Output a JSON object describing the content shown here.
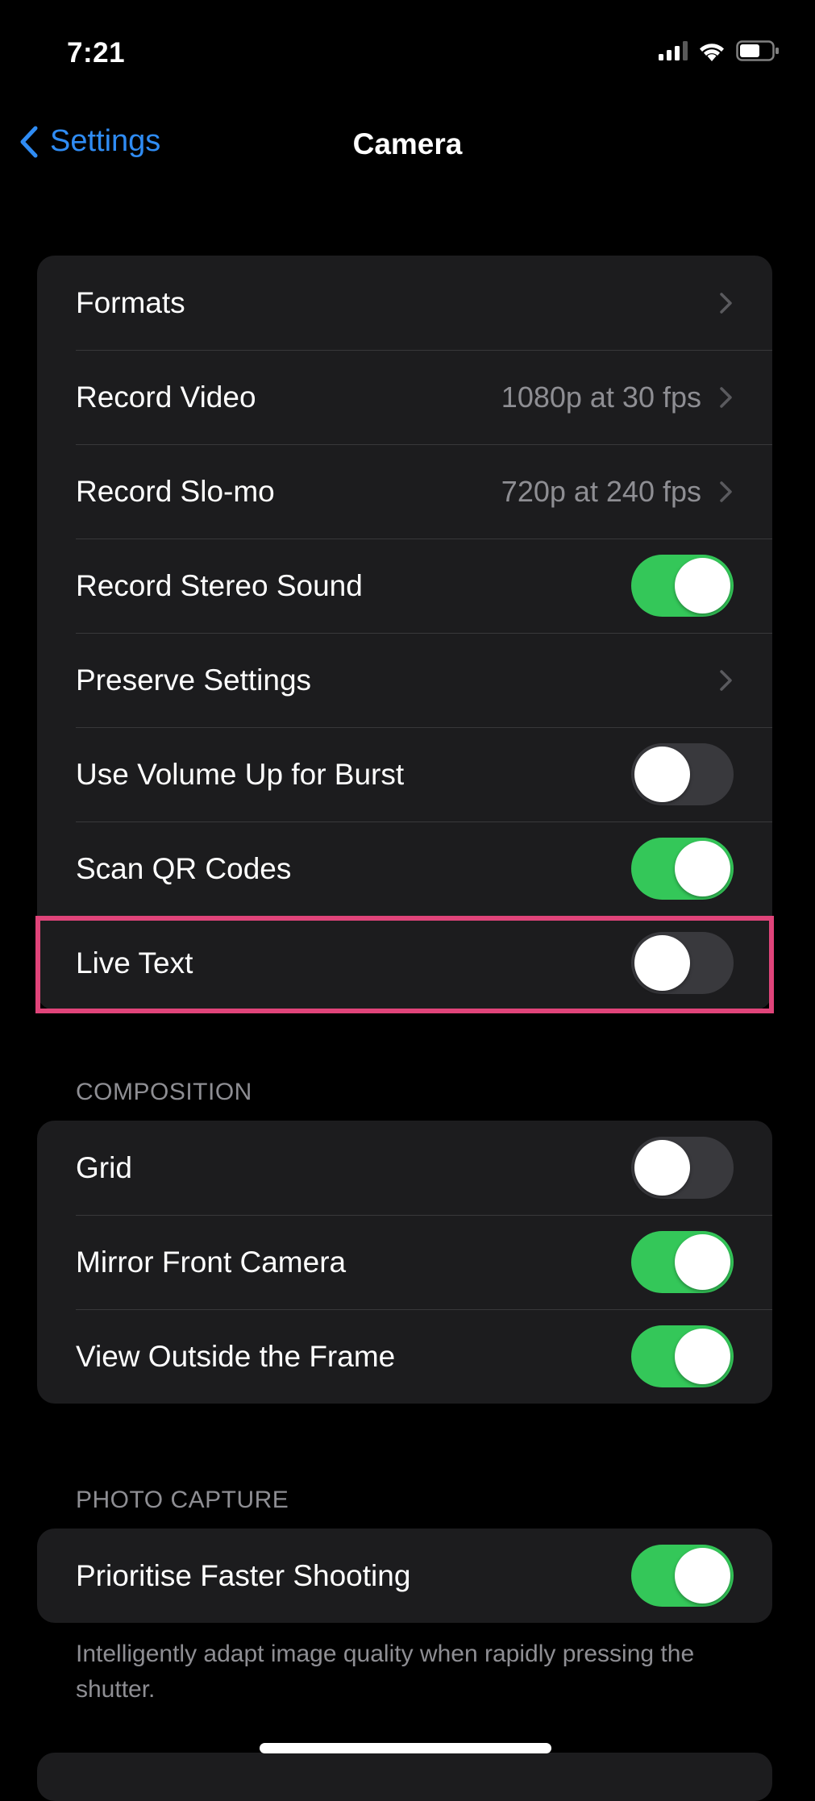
{
  "status_bar": {
    "time": "7:21",
    "icons": [
      "cellular-signal-icon",
      "wifi-icon",
      "battery-icon"
    ]
  },
  "nav": {
    "back_label": "Settings",
    "title": "Camera"
  },
  "colors": {
    "accent": "#2f8cf4",
    "toggle_on": "#34c759",
    "toggle_off": "#39393d",
    "highlight": "#e0447a"
  },
  "main_group": {
    "rows": [
      {
        "label": "Formats",
        "type": "disclosure",
        "value": ""
      },
      {
        "label": "Record Video",
        "type": "disclosure",
        "value": "1080p at 30 fps"
      },
      {
        "label": "Record Slo-mo",
        "type": "disclosure",
        "value": "720p at 240 fps"
      },
      {
        "label": "Record Stereo Sound",
        "type": "toggle",
        "on": true
      },
      {
        "label": "Preserve Settings",
        "type": "disclosure",
        "value": ""
      },
      {
        "label": "Use Volume Up for Burst",
        "type": "toggle",
        "on": false
      },
      {
        "label": "Scan QR Codes",
        "type": "toggle",
        "on": true
      },
      {
        "label": "Live Text",
        "type": "toggle",
        "on": false,
        "highlighted": true
      }
    ]
  },
  "composition": {
    "header": "COMPOSITION",
    "rows": [
      {
        "label": "Grid",
        "type": "toggle",
        "on": false
      },
      {
        "label": "Mirror Front Camera",
        "type": "toggle",
        "on": true
      },
      {
        "label": "View Outside the Frame",
        "type": "toggle",
        "on": true
      }
    ]
  },
  "photo_capture": {
    "header": "PHOTO CAPTURE",
    "rows": [
      {
        "label": "Prioritise Faster Shooting",
        "type": "toggle",
        "on": true
      }
    ],
    "footnote": "Intelligently adapt image quality when rapidly pressing the shutter."
  }
}
